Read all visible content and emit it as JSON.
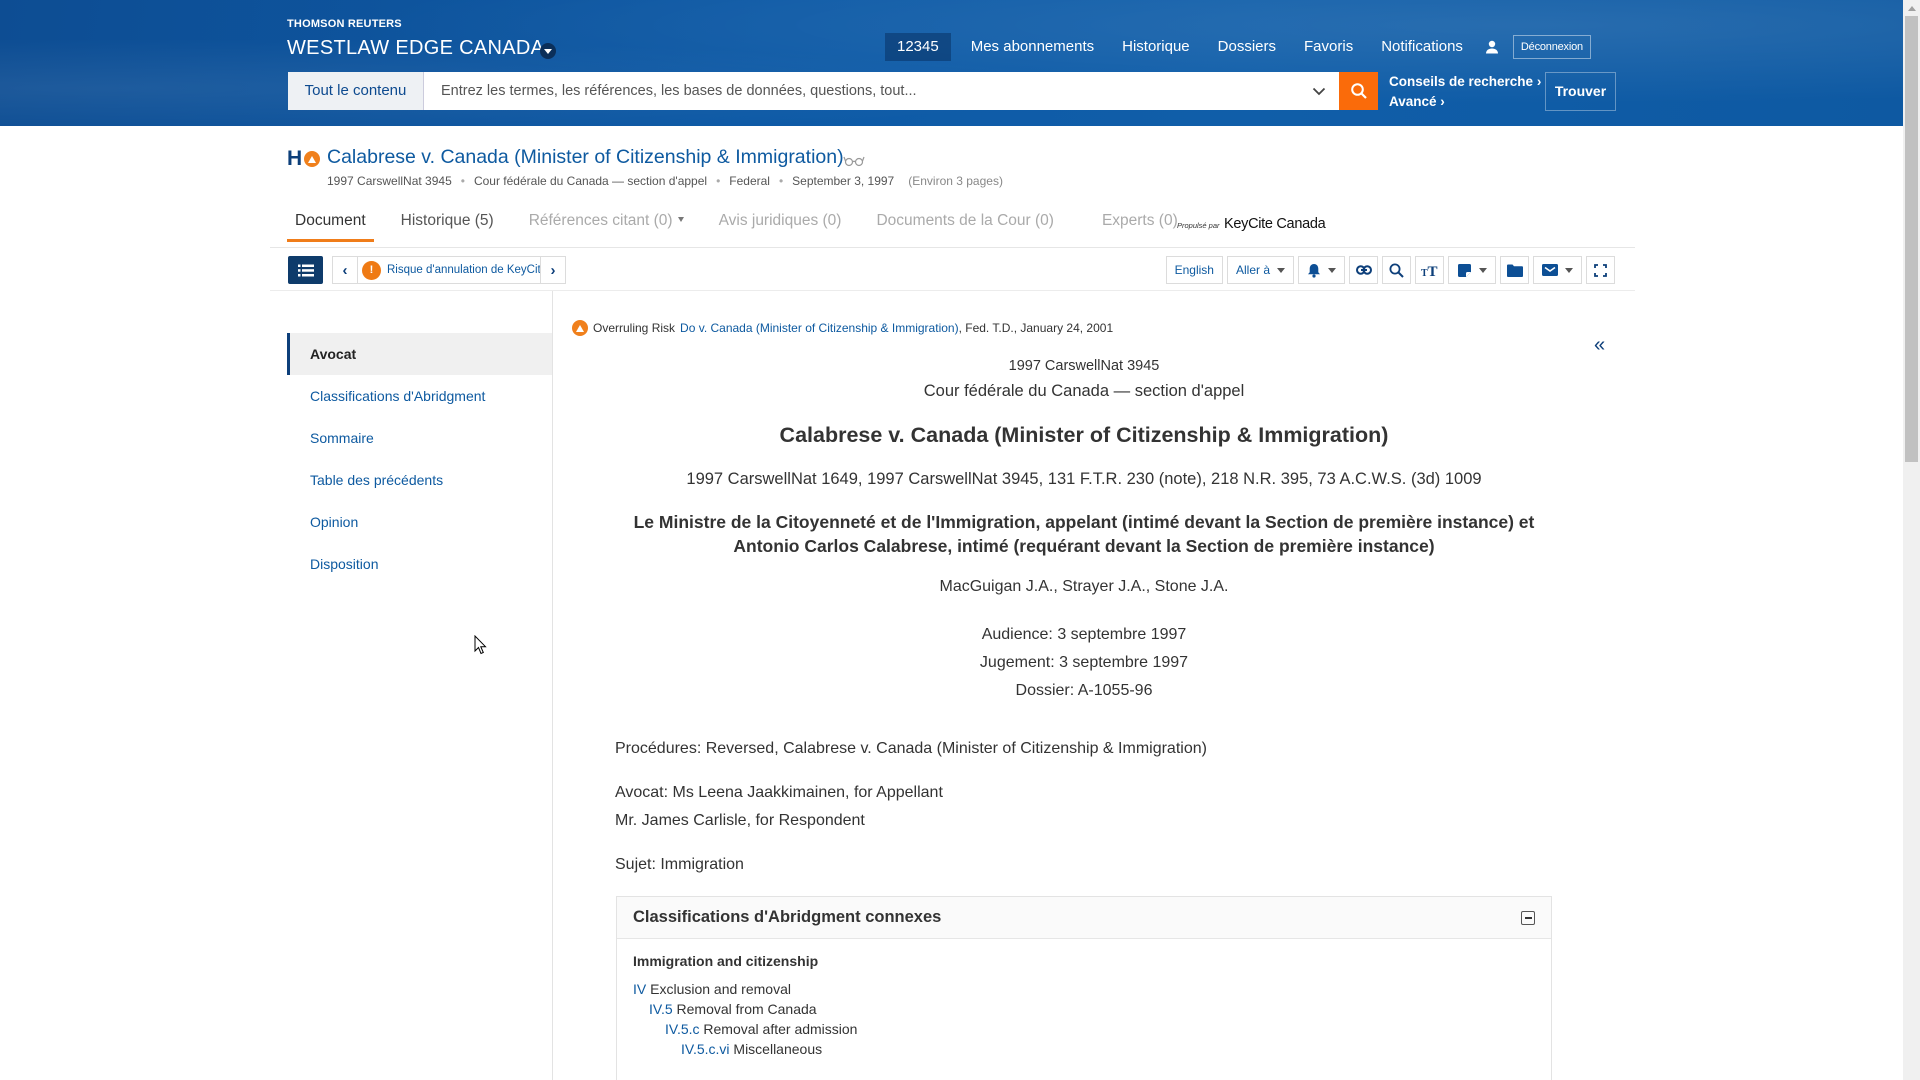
{
  "header": {
    "brand_top": "THOMSON REUTERS",
    "brand_title": "WESTLAW EDGE CANADA",
    "nav": {
      "account": "12345",
      "items": [
        "Mes abonnements",
        "Historique",
        "Dossiers",
        "Favoris",
        "Notifications"
      ],
      "logout": "Déconnexion"
    },
    "search": {
      "scope": "Tout le contenu",
      "placeholder": "Entrez les termes, les références, les bases de données, questions, tout...",
      "value": "",
      "tips": "Conseils de recherche ›",
      "advanced": "Avancé ›",
      "find": "Trouver"
    }
  },
  "document": {
    "flag_letter": "H",
    "title": "Calabrese v. Canada (Minister of Citizenship & Immigration)",
    "meta": {
      "citation": "1997 CarswellNat 3945",
      "court": "Cour fédérale du Canada — section d'appel",
      "jurisdiction": "Federal",
      "date": "September 3, 1997",
      "pages": "(Environ 3 pages)"
    }
  },
  "tabs": [
    {
      "label": "Document",
      "state": "active"
    },
    {
      "label": "Historique (5)",
      "state": "enabled"
    },
    {
      "label": "Références citant (0)",
      "state": "disabled"
    },
    {
      "label": "Avis juridiques (0)",
      "state": "disabled"
    },
    {
      "label": "Documents de la Cour (0)",
      "state": "disabled"
    },
    {
      "label": "Experts (0)",
      "state": "disabled"
    }
  ],
  "keycite": {
    "powered_by": "Propulsé par",
    "name": "KeyCite Canada"
  },
  "toolbar": {
    "keycite_nav_label": "Risque d'annulation de KeyCite",
    "english": "English",
    "goto": "Aller à"
  },
  "sidebar": {
    "items": [
      {
        "label": "Avocat",
        "active": true
      },
      {
        "label": "Classifications d'Abridgment",
        "active": false
      },
      {
        "label": "Sommaire",
        "active": false
      },
      {
        "label": "Table des précédents",
        "active": false
      },
      {
        "label": "Opinion",
        "active": false
      },
      {
        "label": "Disposition",
        "active": false
      }
    ]
  },
  "content": {
    "overruling": {
      "prefix": "Overruling Risk",
      "case_link": "Do v. Canada (Minister of Citizenship & Immigration)",
      "suffix": ", Fed. T.D., January 24, 2001"
    },
    "citation": "1997 CarswellNat 3945",
    "court": "Cour fédérale du Canada — section d'appel",
    "title": "Calabrese v. Canada (Minister of Citizenship & Immigration)",
    "reports": "1997 CarswellNat 1649, 1997 CarswellNat 3945, 131 F.T.R. 230 (note), 218 N.R. 395, 73 A.C.W.S. (3d) 1009",
    "parties_line1": "Le Ministre de la Citoyenneté et de l'Immigration, appelant (intimé devant la Section de première instance) et",
    "parties_line2": "Antonio Carlos Calabrese, intimé (requérant devant la Section de première instance)",
    "judges": "MacGuigan J.A., Strayer J.A., Stone J.A.",
    "hearing": "Audience: 3 septembre 1997",
    "judgment": "Jugement: 3 septembre 1997",
    "docket": "Dossier: A-1055-96",
    "procedures": "Procédures: Reversed, Calabrese v. Canada (Minister of Citizenship & Immigration)",
    "counsel_line1": "Avocat: Ms Leena Jaakkimainen, for Appellant",
    "counsel_line2": "Mr. James Carlisle, for Respondent",
    "subject": "Sujet: Immigration",
    "abridgment": {
      "title": "Classifications d'Abridgment connexes",
      "topic": "Immigration and citizenship",
      "rows": [
        {
          "code": "IV",
          "text": " Exclusion and removal"
        },
        {
          "code": "IV.5",
          "text": " Removal from Canada"
        },
        {
          "code": "IV.5.c",
          "text": " Removal after admission"
        },
        {
          "code": "IV.5.c.vi",
          "text": " Miscellaneous"
        }
      ]
    }
  },
  "colors": {
    "header_blue": "#0e5aa6",
    "accent_orange": "#fa6b0a",
    "link_blue": "#0e5aa0",
    "navy": "#0d3f7a",
    "warning_orange": "#ef7a14"
  }
}
